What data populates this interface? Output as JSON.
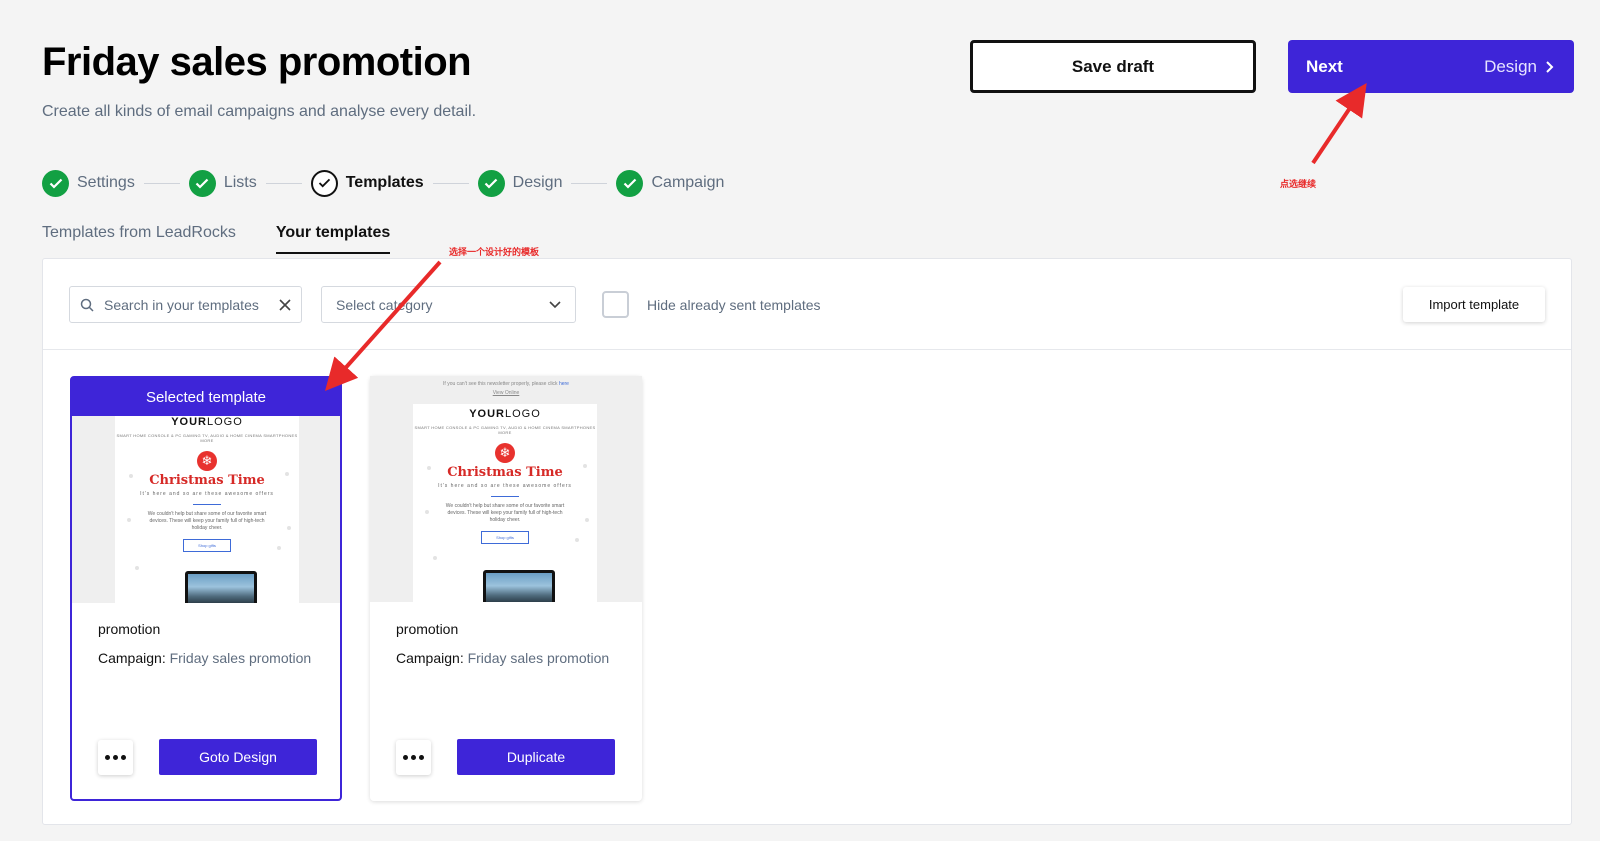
{
  "header": {
    "title": "Friday sales promotion",
    "subtitle": "Create all kinds of email campaigns and analyse every detail.",
    "save_draft_label": "Save draft",
    "next_label": "Next",
    "next_step_label": "Design"
  },
  "steps": [
    {
      "label": "Settings",
      "state": "done"
    },
    {
      "label": "Lists",
      "state": "done"
    },
    {
      "label": "Templates",
      "state": "current"
    },
    {
      "label": "Design",
      "state": "done"
    },
    {
      "label": "Campaign",
      "state": "done"
    }
  ],
  "tabs": [
    {
      "label": "Templates from LeadRocks",
      "active": false
    },
    {
      "label": "Your templates",
      "active": true
    }
  ],
  "toolbar": {
    "search_placeholder": "Search in your templates",
    "category_placeholder": "Select category",
    "hide_sent_label": "Hide already sent templates",
    "hide_sent_checked": false,
    "import_label": "Import template"
  },
  "thumbnail": {
    "preheader": "If you can't see this newsletter properly, please click",
    "preheader_link": "here",
    "view_online": "View Online",
    "logo_bold": "YOUR",
    "logo_rest": "LOGO",
    "nav": "SMART HOME   CONSOLE & PC GAMING   TV, AUDIO & HOME CINEMA   SMARTPHONES   MORE",
    "headline": "Christmas Time",
    "subheadline": "It's here and so are these awesome offers",
    "body": "We couldn't help but share some of our favorite smart devices. These will keep your family full of high-tech holiday cheer.",
    "cta": "Shop gifts"
  },
  "templates": [
    {
      "banner": "Selected template",
      "selected": true,
      "name": "promotion",
      "campaign_label": "Campaign:",
      "campaign_value": "Friday sales promotion",
      "action_label": "Goto Design"
    },
    {
      "banner": "",
      "selected": false,
      "name": "promotion",
      "campaign_label": "Campaign:",
      "campaign_value": "Friday sales promotion",
      "action_label": "Duplicate"
    }
  ],
  "annotations": {
    "next_hint": "点选继续",
    "template_hint": "选择一个设计好的模板"
  },
  "colors": {
    "primary": "#3e25d8",
    "success": "#12a043",
    "annotation": "#e82a2a"
  }
}
